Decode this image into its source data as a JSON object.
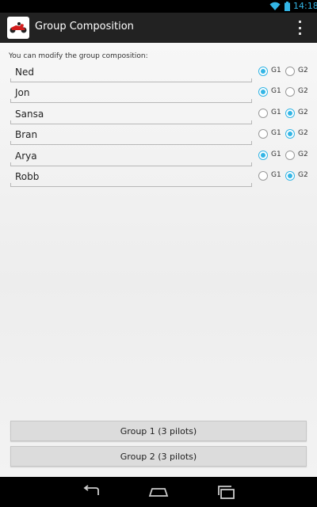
{
  "status_bar": {
    "time": "14:18"
  },
  "action_bar": {
    "title": "Group Composition",
    "app_icon": "kart-icon",
    "overflow_icon": "overflow-menu-icon"
  },
  "intro_text": "You can modify the group composition:",
  "radio_labels": {
    "g1": "G1",
    "g2": "G2"
  },
  "pilots": [
    {
      "name": "Ned",
      "group": "G1"
    },
    {
      "name": "Jon",
      "group": "G1"
    },
    {
      "name": "Sansa",
      "group": "G2"
    },
    {
      "name": "Bran",
      "group": "G2"
    },
    {
      "name": "Arya",
      "group": "G1"
    },
    {
      "name": "Robb",
      "group": "G2"
    }
  ],
  "buttons": {
    "group1": "Group 1 (3 pilots)",
    "group2": "Group 2 (3 pilots)"
  },
  "nav": {
    "back_icon": "back-icon",
    "home_icon": "home-icon",
    "recents_icon": "recents-icon"
  },
  "colors": {
    "accent": "#33b5e5",
    "action_bar": "#222222"
  }
}
